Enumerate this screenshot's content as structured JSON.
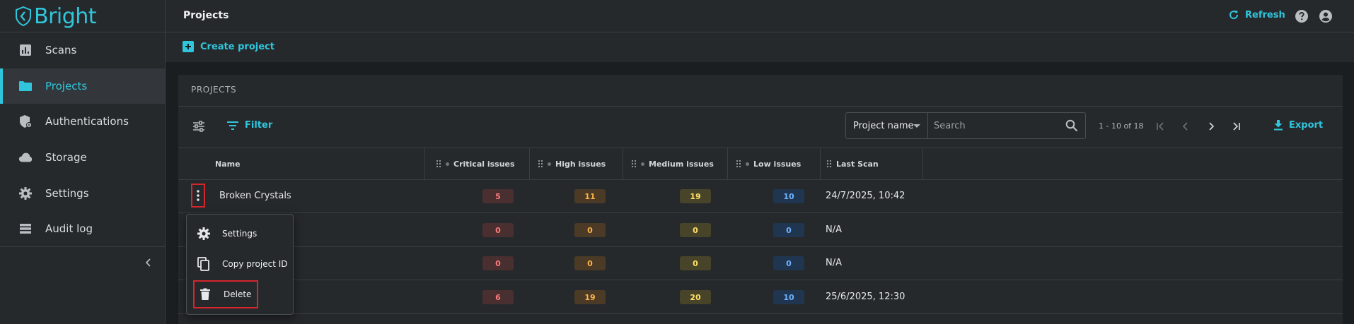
{
  "app": {
    "brand": "Bright"
  },
  "sidebar": {
    "items": [
      {
        "label": "Scans",
        "icon": "chart-icon"
      },
      {
        "label": "Projects",
        "icon": "folder-icon",
        "active": true
      },
      {
        "label": "Authentications",
        "icon": "shield-lock-icon"
      },
      {
        "label": "Storage",
        "icon": "cloud-icon"
      },
      {
        "label": "Settings",
        "icon": "gear-icon"
      },
      {
        "label": "Audit log",
        "icon": "list-icon"
      }
    ],
    "collapse_icon": "chevron-left-icon"
  },
  "header": {
    "title": "Projects",
    "refresh_label": "Refresh"
  },
  "actions": {
    "create_label": "Create project"
  },
  "panel": {
    "title": "PROJECTS",
    "filter_label": "Filter",
    "search_field": "Project name",
    "search_placeholder": "Search",
    "range_text": "1 - 10 of 18",
    "export_label": "Export"
  },
  "table": {
    "columns": [
      "Name",
      "Critical issues",
      "High issues",
      "Medium issues",
      "Low issues",
      "Last Scan"
    ],
    "rows": [
      {
        "name": "Broken Crystals",
        "critical": "5",
        "high": "11",
        "medium": "19",
        "low": "10",
        "last_scan": "24/7/2025, 10:42"
      },
      {
        "name": "",
        "critical": "0",
        "high": "0",
        "medium": "0",
        "low": "0",
        "last_scan": "N/A"
      },
      {
        "name": "",
        "critical": "0",
        "high": "0",
        "medium": "0",
        "low": "0",
        "last_scan": "N/A"
      },
      {
        "name": "",
        "critical": "6",
        "high": "19",
        "medium": "20",
        "low": "10",
        "last_scan": "25/6/2025, 12:30"
      }
    ]
  },
  "row_menu": {
    "items": [
      {
        "label": "Settings",
        "icon": "gear-icon"
      },
      {
        "label": "Copy project ID",
        "icon": "copy-icon"
      },
      {
        "label": "Delete",
        "icon": "trash-icon"
      }
    ]
  },
  "colors": {
    "accent": "#2fc6dc",
    "background": "#1b1e21",
    "surface": "#26292c",
    "highlight_outline": "#d3262d"
  }
}
